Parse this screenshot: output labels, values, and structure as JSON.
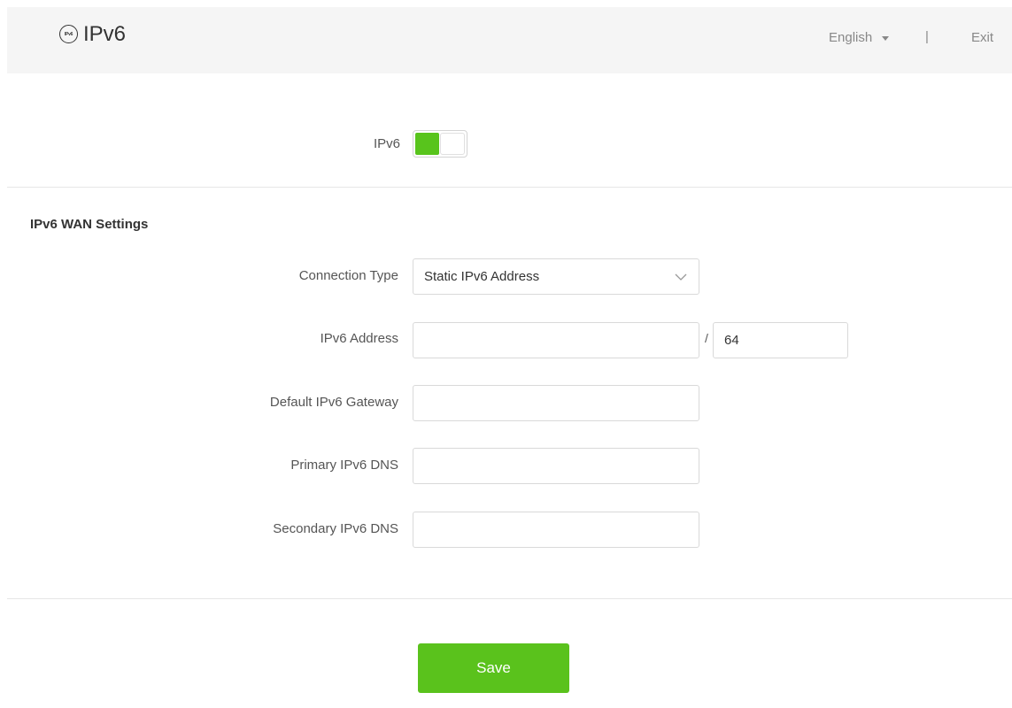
{
  "header": {
    "icon_text": "IPv6",
    "title": "IPv6",
    "language": "English",
    "separator": "|",
    "exit_label": "Exit"
  },
  "ipv6_toggle": {
    "label": "IPv6",
    "enabled": true
  },
  "wan_settings": {
    "section_title": "IPv6 WAN Settings",
    "connection_type": {
      "label": "Connection Type",
      "value": "Static IPv6 Address"
    },
    "ipv6_address": {
      "label": "IPv6 Address",
      "value": "",
      "separator": "/",
      "prefix_length": "64"
    },
    "default_gateway": {
      "label": "Default IPv6 Gateway",
      "value": ""
    },
    "primary_dns": {
      "label": "Primary IPv6 DNS",
      "value": ""
    },
    "secondary_dns": {
      "label": "Secondary IPv6 DNS",
      "value": ""
    }
  },
  "actions": {
    "save_label": "Save"
  },
  "colors": {
    "accent": "#5ac21c",
    "header_bg": "#f5f5f5"
  }
}
